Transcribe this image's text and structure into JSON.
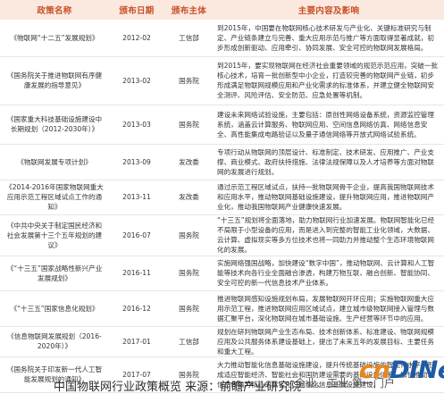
{
  "header": {
    "col_name": "政策名称",
    "col_date": "颁布日期",
    "col_body": "颁布主体",
    "col_content": "主要内容及影响"
  },
  "rows": [
    {
      "name": "《物联网“十二五”发展规划》",
      "date": "2012-02",
      "body": "工信部",
      "content": "到2015年，中国要在物联网核心技术研发与产业化、关键标准研究与制定、产业链条建立与完善、重大应用示范与推广等方面取得显著成就，初步形成创新驱动、应用牵引、协同发展、安全可控的物联网发展格局。"
    },
    {
      "name": "《国务院关于推进物联网有序健康发展的指导意见》",
      "date": "2013-02",
      "body": "国务院",
      "content": "到2015年，要实现物联网在经济社会重要领域的规范示范应用，突破一批核心技术，培育一批创新型中小企业，打造较完善的物联网产业链，初步形成满足物联网规模应用和产业化需求的标准体系，并建立健全物联网安全测评、风险评估、安全防范、应急处置等机制。"
    },
    {
      "name": "《国家重大科技基础设施建设中长期规划（2012-2030年）》",
      "date": "2013-03",
      "body": "国务院",
      "content": "建设未来网络试验设施，主要包括：原创性网络设备系统，资源监控管理系统，涵盖云计算服务、物联网应用、空间信息网络仿真、网络信息安全、高性能集成电路验证以及量子通信网络等开放式网络试验系统。"
    },
    {
      "name": "《物联网发展专项计划》",
      "date": "2013-09",
      "body": "发改委",
      "content": "专项行动从物联网的顶层设计、标准制定、技术研发、应用推广、产业支撑、商业模式、政府扶持措施、法律法规保障以及人才培养等方面对物联网的发展进行规划。"
    },
    {
      "name": "《2014-2016年国家物联网重大应用示范工程区域试点工作的通知》",
      "date": "2013-11",
      "body": "发改委",
      "content": "通过示范工程区域试点，扶持一批物联网骨干企业，提高我国物联网技术和应用水平，推动物联网基础设施建设，提升物联网应用，推进物联网产业化，推动我国物联网产业健康快速发展。"
    },
    {
      "name": "《中共中央关于制定国民经济和社会发展第十三个五年规划的建议》",
      "date": "2016-07",
      "body": "国务院",
      "content": "“十三五”规划将全面落地，助力物联网行业加速发展。物联网智能化已经不局限于小型设备的应用，而是进入到完整的智能工业化领域，大数据、云计算、虚拟现实等多方位技术也将一同助力并推动整个生态环境物联网化的发展。"
    },
    {
      "name": "《“十三五”国家战略性新兴产业发展规划》",
      "date": "2016-11",
      "body": "国务院",
      "content": "实施网络强国战略，加快建设“数字中国”，推动物联网、云计算和人工智能等技术向各行业全面融合渗透，构建万物互联、融合创新、智能协同、安全可控的新一代信息技术产业体系。"
    },
    {
      "name": "《“十三五”国家信息化规划》",
      "date": "2016-12",
      "body": "国务院",
      "content": "推进物联网感知设施规划布局，发展物联网开环应用；实施物联网重大应用示范工程，推进物联网应用区域试点，建立城市级物联网接入管理与数据汇聚平台，深化物联网在城市基础设施、生产经营等环节中的应用。"
    },
    {
      "name": "《信息物联网发展规划（2016-2020年）》",
      "date": "2017-01",
      "body": "工信部",
      "content": "规划在研判物联网产业生态布局、技术创新体系、标准建设、物联网规模应用及公共服务体系建设基础上，提出了未来五年的发展目标、主要任务和重大工程。"
    },
    {
      "name": "《国务院关于印发新一代人工智能发展规划的通知》",
      "date": "2017-07",
      "body": "国务院",
      "content": "大力推动智能化信息基础设施建设，提升传统基础设施的智能化水平，形成适应智能经济、智能社会和国防建设需要的基础设施体系，加快推动以信息传输为核心的数字化、网络化信息基础设施建设。"
    }
  ],
  "caption": "中国物联网行业政策概览 来源：前瞻产业研究院",
  "watermark": {
    "cn_text": "企业、工业 第一门户",
    "logo_part1": "cn",
    "logo_part2": "DINet"
  },
  "colors": {
    "header_bg": "#fbe9df",
    "header_text": "#c9502a",
    "logo_orange": "#e8861a",
    "logo_blue": "#1d5aa6"
  }
}
